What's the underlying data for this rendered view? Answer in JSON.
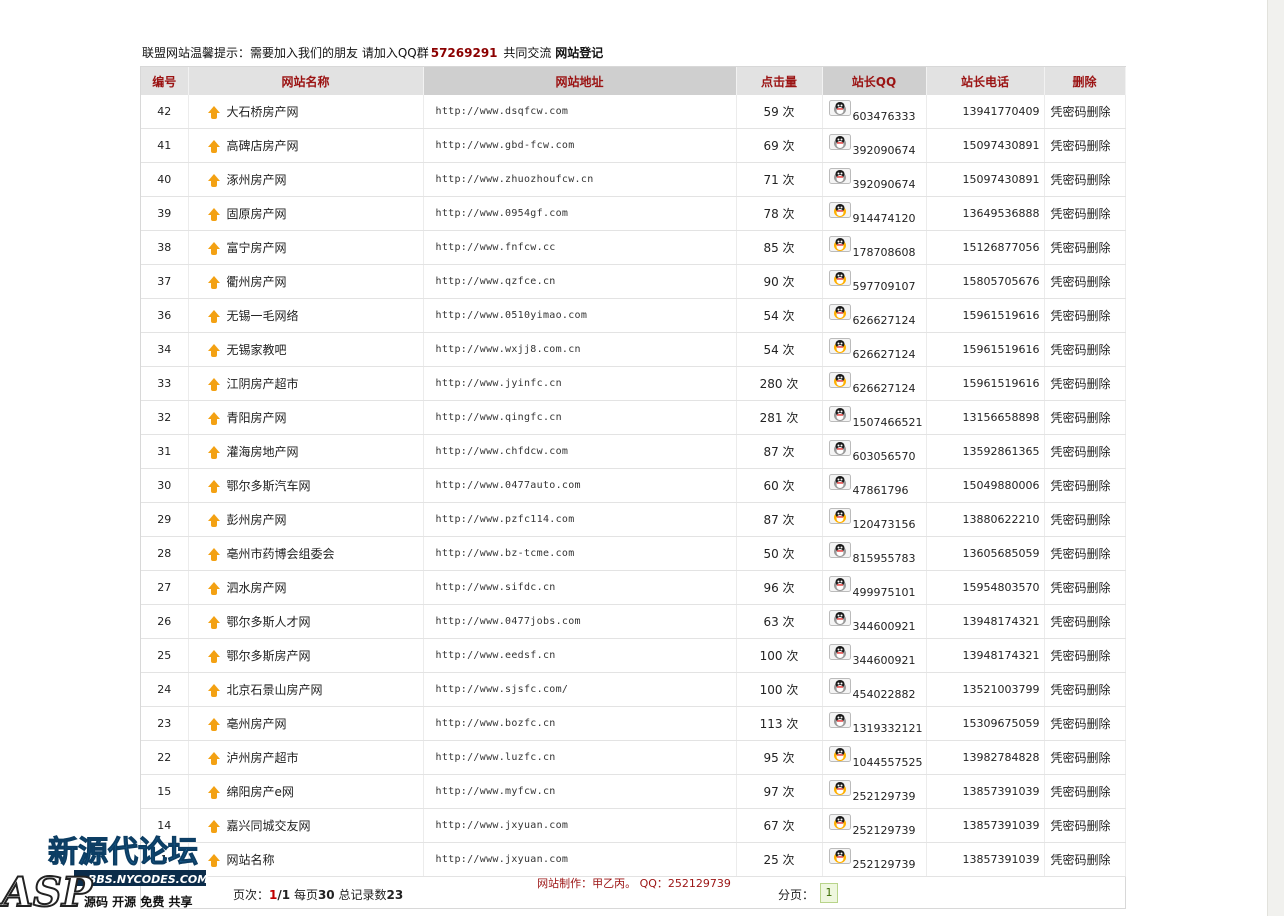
{
  "notice": {
    "text": "联盟网站温馨提示：需要加入我们的朋友 请加入QQ群",
    "qq_group": "57269291",
    "after": "共同交流",
    "register_link": "网站登记"
  },
  "columns": [
    "编号",
    "网站名称",
    "网站地址",
    "点击量",
    "站长QQ",
    "站长电话",
    "删除"
  ],
  "rows": [
    {
      "id": "42",
      "name": "大石桥房产网",
      "url": "http://www.dsqfcw.com",
      "clicks": "59 次",
      "qq": "603476333",
      "qq_online": false,
      "phone": "13941770409",
      "action": "凭密码删除"
    },
    {
      "id": "41",
      "name": "高碑店房产网",
      "url": "http://www.gbd-fcw.com",
      "clicks": "69 次",
      "qq": "392090674",
      "qq_online": false,
      "phone": "15097430891",
      "action": "凭密码删除"
    },
    {
      "id": "40",
      "name": "涿州房产网",
      "url": "http://www.zhuozhoufcw.cn",
      "clicks": "71 次",
      "qq": "392090674",
      "qq_online": false,
      "phone": "15097430891",
      "action": "凭密码删除"
    },
    {
      "id": "39",
      "name": "固原房产网",
      "url": "http://www.0954gf.com",
      "clicks": "78 次",
      "qq": "914474120",
      "qq_online": true,
      "phone": "13649536888",
      "action": "凭密码删除"
    },
    {
      "id": "38",
      "name": "富宁房产网",
      "url": "http://www.fnfcw.cc",
      "clicks": "85 次",
      "qq": "178708608",
      "qq_online": true,
      "phone": "15126877056",
      "action": "凭密码删除"
    },
    {
      "id": "37",
      "name": "衢州房产网",
      "url": "http://www.qzfce.cn",
      "clicks": "90 次",
      "qq": "597709107",
      "qq_online": true,
      "phone": "15805705676",
      "action": "凭密码删除"
    },
    {
      "id": "36",
      "name": "无锡一毛网络",
      "url": "http://www.0510yimao.com",
      "clicks": "54 次",
      "qq": "626627124",
      "qq_online": true,
      "phone": "15961519616",
      "action": "凭密码删除"
    },
    {
      "id": "34",
      "name": "无锡家教吧",
      "url": "http://www.wxjj8.com.cn",
      "clicks": "54 次",
      "qq": "626627124",
      "qq_online": true,
      "phone": "15961519616",
      "action": "凭密码删除"
    },
    {
      "id": "33",
      "name": "江阴房产超市",
      "url": "http://www.jyinfc.cn",
      "clicks": "280 次",
      "qq": "626627124",
      "qq_online": true,
      "phone": "15961519616",
      "action": "凭密码删除"
    },
    {
      "id": "32",
      "name": "青阳房产网",
      "url": "http://www.qingfc.cn",
      "clicks": "281 次",
      "qq": "1507466521",
      "qq_online": false,
      "phone": "13156658898",
      "action": "凭密码删除"
    },
    {
      "id": "31",
      "name": "灌海房地产网",
      "url": "http://www.chfdcw.com",
      "clicks": "87 次",
      "qq": "603056570",
      "qq_online": false,
      "phone": "13592861365",
      "action": "凭密码删除"
    },
    {
      "id": "30",
      "name": "鄂尔多斯汽车网",
      "url": "http://www.0477auto.com",
      "clicks": "60 次",
      "qq": "47861796",
      "qq_online": false,
      "phone": "15049880006",
      "action": "凭密码删除"
    },
    {
      "id": "29",
      "name": "彭州房产网",
      "url": "http://www.pzfc114.com",
      "clicks": "87 次",
      "qq": "120473156",
      "qq_online": true,
      "phone": "13880622210",
      "action": "凭密码删除"
    },
    {
      "id": "28",
      "name": "亳州市药博会组委会",
      "url": "http://www.bz-tcme.com",
      "clicks": "50 次",
      "qq": "815955783",
      "qq_online": false,
      "phone": "13605685059",
      "action": "凭密码删除"
    },
    {
      "id": "27",
      "name": "泗水房产网",
      "url": "http://www.sifdc.cn",
      "clicks": "96 次",
      "qq": "499975101",
      "qq_online": false,
      "phone": "15954803570",
      "action": "凭密码删除"
    },
    {
      "id": "26",
      "name": "鄂尔多斯人才网",
      "url": "http://www.0477jobs.com",
      "clicks": "63 次",
      "qq": "344600921",
      "qq_online": false,
      "phone": "13948174321",
      "action": "凭密码删除"
    },
    {
      "id": "25",
      "name": "鄂尔多斯房产网",
      "url": "http://www.eedsf.cn",
      "clicks": "100 次",
      "qq": "344600921",
      "qq_online": false,
      "phone": "13948174321",
      "action": "凭密码删除"
    },
    {
      "id": "24",
      "name": "北京石景山房产网",
      "url": "http://www.sjsfc.com/",
      "clicks": "100 次",
      "qq": "454022882",
      "qq_online": false,
      "phone": "13521003799",
      "action": "凭密码删除"
    },
    {
      "id": "23",
      "name": "亳州房产网",
      "url": "http://www.bozfc.cn",
      "clicks": "113 次",
      "qq": "1319332121",
      "qq_online": false,
      "phone": "15309675059",
      "action": "凭密码删除"
    },
    {
      "id": "22",
      "name": "泸州房产超市",
      "url": "http://www.luzfc.cn",
      "clicks": "95 次",
      "qq": "1044557525",
      "qq_online": true,
      "phone": "13982784828",
      "action": "凭密码删除"
    },
    {
      "id": "15",
      "name": "绵阳房产e网",
      "url": "http://www.myfcw.cn",
      "clicks": "97 次",
      "qq": "252129739",
      "qq_online": true,
      "phone": "13857391039",
      "action": "凭密码删除"
    },
    {
      "id": "14",
      "name": "嘉兴同城交友网",
      "url": "http://www.jxyuan.com",
      "clicks": "67 次",
      "qq": "252129739",
      "qq_online": true,
      "phone": "13857391039",
      "action": "凭密码删除"
    },
    {
      "id": "1",
      "name": "网站名称",
      "url": "http://www.jxyuan.com",
      "clicks": "25 次",
      "qq": "252129739",
      "qq_online": true,
      "phone": "13857391039",
      "action": "凭密码删除"
    }
  ],
  "pager": {
    "pages_label": "页次：",
    "current": "1",
    "total": "/1",
    "per_page_label": "每页",
    "per_page": "30",
    "total_label": "总记录数",
    "total_records": "23",
    "page_nav_label": "分页：",
    "page_button": "1"
  },
  "footer": {
    "maker": "网站制作：甲乙丙。",
    "qq": "QQ：252129739"
  },
  "watermark": {
    "title": "新源代论坛",
    "domain": "BBS.NYCODES.COM",
    "logo": "ASP",
    "tags": "源码 开源 免费 共享"
  },
  "colors": {
    "header_text": "#9b1313",
    "qq_group": "#8b0000",
    "arrow_icon": "#f3a113",
    "qq_online": "#ffb000",
    "qq_offline": "#9a9a9a"
  }
}
